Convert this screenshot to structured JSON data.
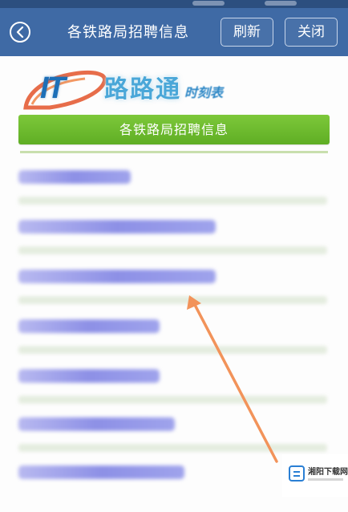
{
  "header": {
    "title": "各铁路局招聘信息",
    "refresh_label": "刷新",
    "close_label": "关闭"
  },
  "logo": {
    "mark": "IT",
    "word": "路路通",
    "sub": "时刻表"
  },
  "section": {
    "heading": "各铁路局招聘信息"
  },
  "list": {
    "items": [
      {
        "label": "",
        "fill": 0.36
      },
      {
        "label": "",
        "fill": 0.63
      },
      {
        "label": "",
        "fill": 0.63
      },
      {
        "label": "",
        "fill": 0.45
      },
      {
        "label": "",
        "fill": 0.45
      },
      {
        "label": "",
        "fill": 0.5
      },
      {
        "label": "",
        "fill": 0.53
      }
    ]
  },
  "watermark": {
    "text": "湘阳下载网"
  },
  "colors": {
    "header": "#3f6aa5",
    "green": "#6aba2c",
    "arrow": "#f2935a",
    "link": "#8d90e6"
  },
  "icons": {
    "back": "chevron-left-icon",
    "pointer": "arrow-icon"
  }
}
